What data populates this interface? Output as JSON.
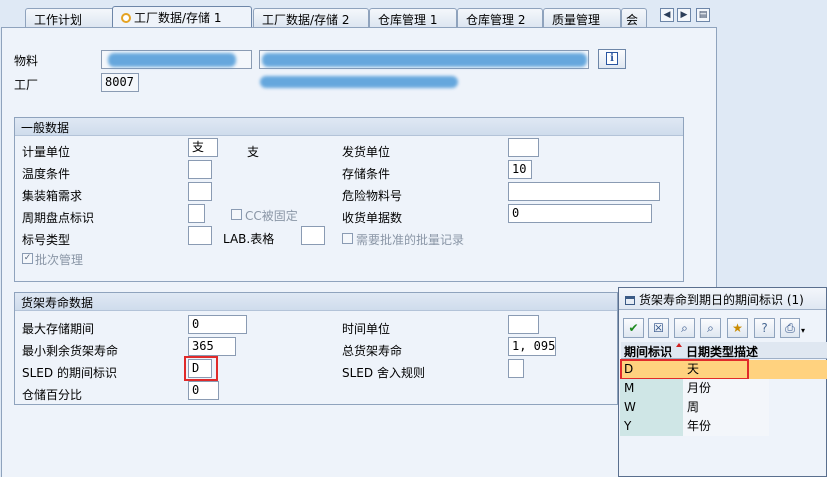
{
  "tabs": [
    {
      "label": "工作计划"
    },
    {
      "label": "工厂数据/存储 1"
    },
    {
      "label": "工厂数据/存储 2"
    },
    {
      "label": "仓库管理 1"
    },
    {
      "label": "仓库管理 2"
    },
    {
      "label": "质量管理"
    },
    {
      "label": "会"
    }
  ],
  "header": {
    "material_label": "物料",
    "plant_label": "工厂",
    "plant_value": "8007",
    "info_icon": "info-icon"
  },
  "general": {
    "title": "一般数据",
    "uom_label": "计量单位",
    "uom_value": "支",
    "uom_text": "支",
    "temp_label": "温度条件",
    "container_label": "集装箱需求",
    "cycle_label": "周期盘点标识",
    "cc_fixed_label": "CC被固定",
    "label_type_label": "标号类型",
    "lab_form_label": "LAB.表格",
    "batch_label": "批次管理",
    "issue_unit_label": "发货单位",
    "storage_cond_label": "存储条件",
    "storage_cond_value": "10",
    "hazmat_label": "危险物料号",
    "gr_slips_label": "收货单据数",
    "gr_slips_value": "0",
    "approved_batch_label": "需要批准的批量记录"
  },
  "shelf": {
    "title": "货架寿命数据",
    "max_storage_label": "最大存储期间",
    "max_storage_value": "0",
    "min_rem_label": "最小剩余货架寿命",
    "min_rem_value": "365",
    "sled_label": "SLED 的期间标识",
    "sled_value": "D",
    "storage_pct_label": "仓储百分比",
    "storage_pct_value": "0",
    "time_unit_label": "时间单位",
    "total_shelf_label": "总货架寿命",
    "total_shelf_value": "1, 095",
    "sled_round_label": "SLED 舍入规则"
  },
  "popup": {
    "title": "货架寿命到期日的期间标识 (1)",
    "col1": "期间标识",
    "col2": "日期类型描述",
    "rows": [
      {
        "code": "D",
        "desc": "天"
      },
      {
        "code": "M",
        "desc": "月份"
      },
      {
        "code": "W",
        "desc": "周"
      },
      {
        "code": "Y",
        "desc": "年份"
      }
    ]
  },
  "colors": {
    "highlight": "#ffd27f",
    "red_box": "#e02a2a",
    "redaction": "#4e9ad8"
  }
}
